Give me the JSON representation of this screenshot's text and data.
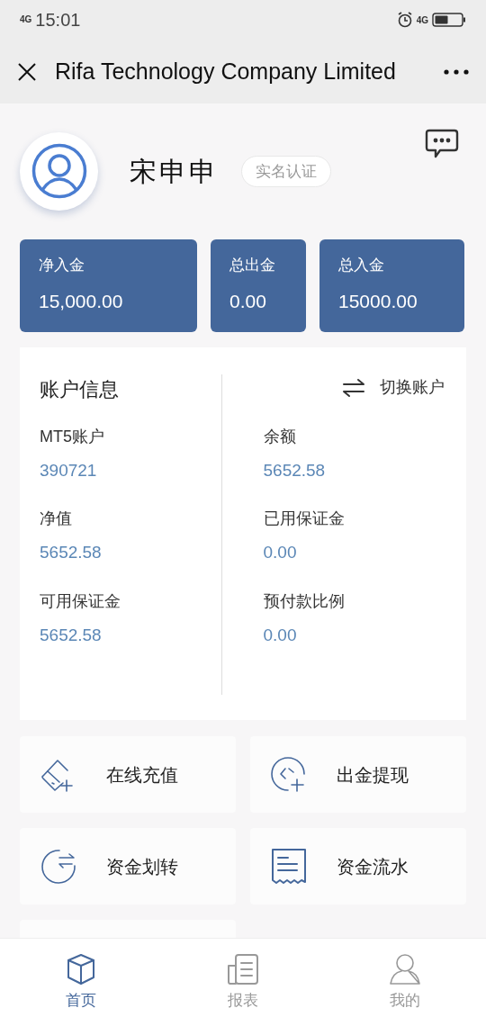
{
  "status_bar": {
    "network": "4G",
    "time": "15:01",
    "network_right": "4G"
  },
  "nav": {
    "title": "Rifa Technology Company Limited"
  },
  "profile": {
    "name": "宋申申",
    "badge": "实名认证"
  },
  "stats": [
    {
      "label": "净入金",
      "value": "15,000.00"
    },
    {
      "label": "总出金",
      "value": "0.00"
    },
    {
      "label": "总入金",
      "value": "15000.00"
    }
  ],
  "account": {
    "title": "账户信息",
    "switch_label": "切换账户",
    "fields": [
      {
        "label": "MT5账户",
        "value": "390721"
      },
      {
        "label": "余额",
        "value": "5652.58"
      },
      {
        "label": "净值",
        "value": "5652.58"
      },
      {
        "label": "已用保证金",
        "value": "0.00"
      },
      {
        "label": "可用保证金",
        "value": "5652.58"
      },
      {
        "label": "预付款比例",
        "value": "0.00"
      }
    ]
  },
  "actions": [
    {
      "kind": "card",
      "label": "在线充值"
    },
    {
      "kind": "withdraw",
      "label": "出金提现"
    },
    {
      "kind": "transfer",
      "label": "资金划转"
    },
    {
      "kind": "receipt",
      "label": "资金流水"
    }
  ],
  "tabs": [
    {
      "kind": "home",
      "label": "首页",
      "selected": true
    },
    {
      "kind": "report",
      "label": "报表",
      "selected": false
    },
    {
      "kind": "me",
      "label": "我的",
      "selected": false
    }
  ]
}
